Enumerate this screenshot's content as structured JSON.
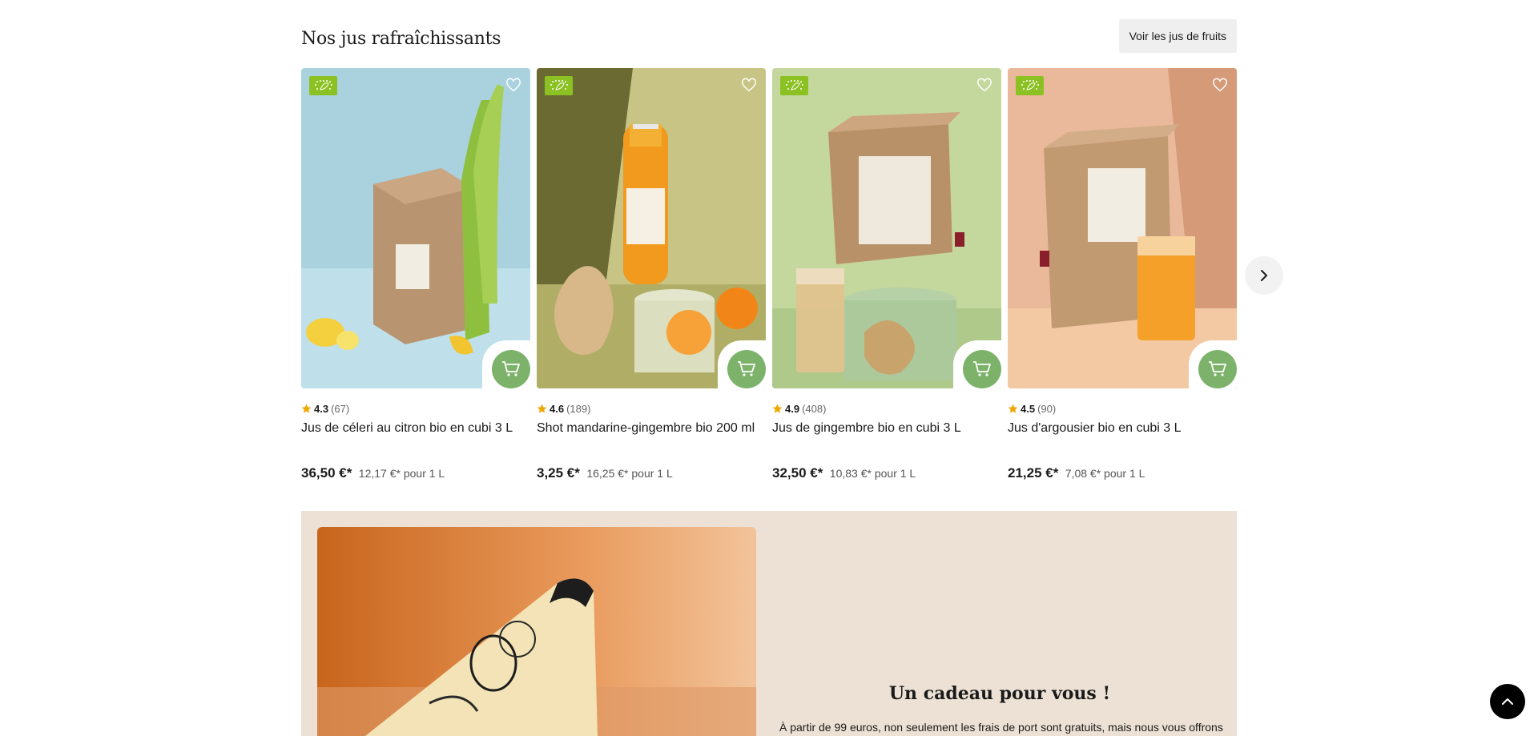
{
  "section": {
    "title": "Nos jus rafraîchissants",
    "see_all_label": "Voir les jus de fruits"
  },
  "products": [
    {
      "name": "Jus de céleri au citron bio en cubi 3 L",
      "rating": "4.3",
      "reviews": "(67)",
      "price": "36,50 €*",
      "unit_price": "12,17 €* pour 1 L",
      "image_bg": "#a9d2de"
    },
    {
      "name": "Shot mandarine-gingembre bio 200 ml",
      "rating": "4.6",
      "reviews": "(189)",
      "price": "3,25 €*",
      "unit_price": "16,25 €* pour 1 L",
      "image_bg": "#c7c486"
    },
    {
      "name": "Jus de gingembre bio en cubi 3 L",
      "rating": "4.9",
      "reviews": "(408)",
      "price": "32,50 €*",
      "unit_price": "10,83 €* pour 1 L",
      "image_bg": "#c4d79d"
    },
    {
      "name": "Jus d'argousier bio en cubi 3 L",
      "rating": "4.5",
      "reviews": "(90)",
      "price": "21,25 €*",
      "unit_price": "7,08 €* pour 1 L",
      "image_bg": "#eab89a"
    }
  ],
  "promo": {
    "title": "Un cadeau pour vous !",
    "text": "À partir de 99 euros, non seulement les frais de port sont gratuits, mais nous vous offrons"
  },
  "icons": {
    "bio": "eu-organic-leaf-icon",
    "favorite": "heart-icon",
    "cart": "cart-icon",
    "next": "chevron-right-icon",
    "scroll_top": "chevron-up-icon",
    "star": "star-icon"
  },
  "colors": {
    "accent_green": "#7cb26a",
    "bio_green": "#8bc122",
    "star": "#f0a500",
    "promo_bg": "#ece1d4"
  }
}
